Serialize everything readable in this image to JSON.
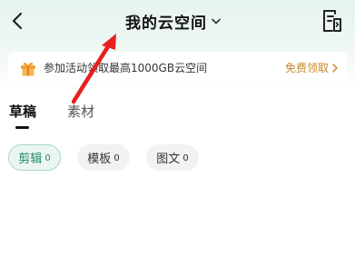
{
  "header": {
    "title": "我的云空间",
    "back_icon": "chevron-left-icon",
    "dropdown_icon": "chevron-down-icon",
    "right_icon": "document-icon"
  },
  "banner": {
    "icon": "gift-icon",
    "text": "参加活动领取最高1000GB云空间",
    "link_label": "免费领取",
    "link_icon": "chevron-right-icon",
    "link_color": "#c98a2e"
  },
  "tabs": [
    {
      "label": "草稿",
      "active": true
    },
    {
      "label": "素材",
      "active": false
    }
  ],
  "filters": [
    {
      "label": "剪辑",
      "count": "0",
      "active": true
    },
    {
      "label": "模板",
      "count": "0",
      "active": false
    },
    {
      "label": "图文",
      "count": "0",
      "active": false
    }
  ],
  "colors": {
    "annotation_arrow": "#e8201e",
    "active_chip_text": "#1f8a6a",
    "header_bg": "#e6f4ef"
  }
}
